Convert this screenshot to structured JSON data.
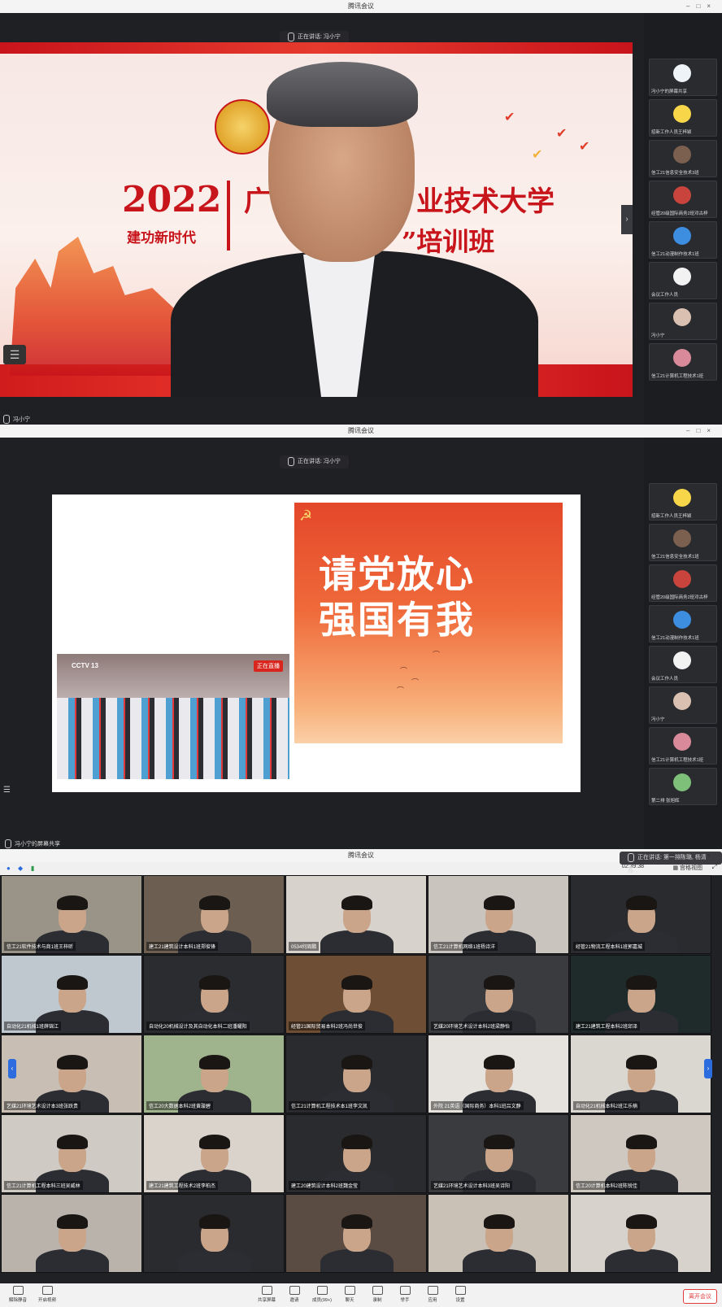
{
  "window_title": "腾讯会议",
  "screen1": {
    "speaking": "正在讲话: 冯小宁",
    "banner_year": "2022",
    "banner_slogan": "建功新时代",
    "banner_title_line1_a": "广",
    "banner_title_line1_b": "业技术大学",
    "banner_title_line2": "”培训班",
    "speaker_name": "冯小宁",
    "sidebar": [
      {
        "name": "冯小宁的屏幕共享",
        "color": "#eef3f8"
      },
      {
        "name": "招新工作人员王梓颖",
        "color": "#f7d64a"
      },
      {
        "name": "信工21信息安全技术3班",
        "color": "#7b6050"
      },
      {
        "name": "经管20级国际商务2班邓古梓",
        "color": "#c8443c"
      },
      {
        "name": "信工21动漫制作技术1班",
        "color": "#3d8de0"
      },
      {
        "name": "会议工作人员",
        "color": "#f2f2f2"
      },
      {
        "name": "冯小宁",
        "color": "#d9c0b0"
      },
      {
        "name": "信工21计算机工程技术1班",
        "color": "#d98a9a"
      }
    ]
  },
  "screen2": {
    "speaking": "正在讲话: 冯小宁",
    "slide_line1": "请党放心",
    "slide_line2": "强国有我",
    "video_logo": "CCTV 13",
    "video_live_badge": "正在直播",
    "share_label": "冯小宁的屏幕共享",
    "sidebar": [
      {
        "name": "招新工作人员王梓颖",
        "color": "#f7d64a"
      },
      {
        "name": "信工21信息安全技术1班",
        "color": "#7b6050"
      },
      {
        "name": "经管20级国际商务2班邓古梓",
        "color": "#c8443c"
      },
      {
        "name": "信工21动漫制作技术1班",
        "color": "#3d8de0"
      },
      {
        "name": "会议工作人员",
        "color": "#f2f2f2"
      },
      {
        "name": "冯小宁",
        "color": "#d9c0b0"
      },
      {
        "name": "信工21计算机工程技术1班",
        "color": "#d98a9a"
      },
      {
        "name": "第二排 张旭辉",
        "color": "#7ec07a"
      }
    ]
  },
  "screen3": {
    "speaking": "正在讲话: 第一排陈璐, 杨清鑫...",
    "timer": "02:39:38",
    "view_label": "宫格视图",
    "participants": [
      "信工21软件技术与商1班王梓昕",
      "建工21建筑设计本科1班郑俊锋",
      "0534何周鹏",
      "信工21计算机网络1班杨诗洋",
      "经管21物流工程本科1班郭嘉城",
      "自动化21机械1班薛锦江",
      "自动化20机械设计及其自动化本科二班潘耀阳",
      "经管21国际贸易本科2班冯尚世俊",
      "艺媒20环境艺术设计本科2班梁静怡",
      "建工21建筑工程本科2班邱泽",
      "艺媒21环境艺术设计本3班张跃贵",
      "信工20大数据本科2班黄璇碧",
      "信工21计算机工程技术本1班李文凯",
      "外院 21英语（国际商务）本科1班吕文静",
      "自动化21机械本科2班江乐楠",
      "信工21计算机工程本科三班吴威林",
      "建工21建筑工程技术2班李柏杰",
      "建工20建筑设计本科2班魏金莹",
      "艺媒21环境艺术设计本科3班吴诗阳",
      "信工20计算机本科2班陈锐佳",
      "",
      "",
      "",
      "",
      ""
    ],
    "toolbar": [
      "解除静音",
      "开启视频",
      "共享屏幕",
      "邀请",
      "成员(99+)",
      "聊天",
      "录制",
      "举手",
      "应用",
      "设置"
    ],
    "leave_label": "离开会议"
  }
}
